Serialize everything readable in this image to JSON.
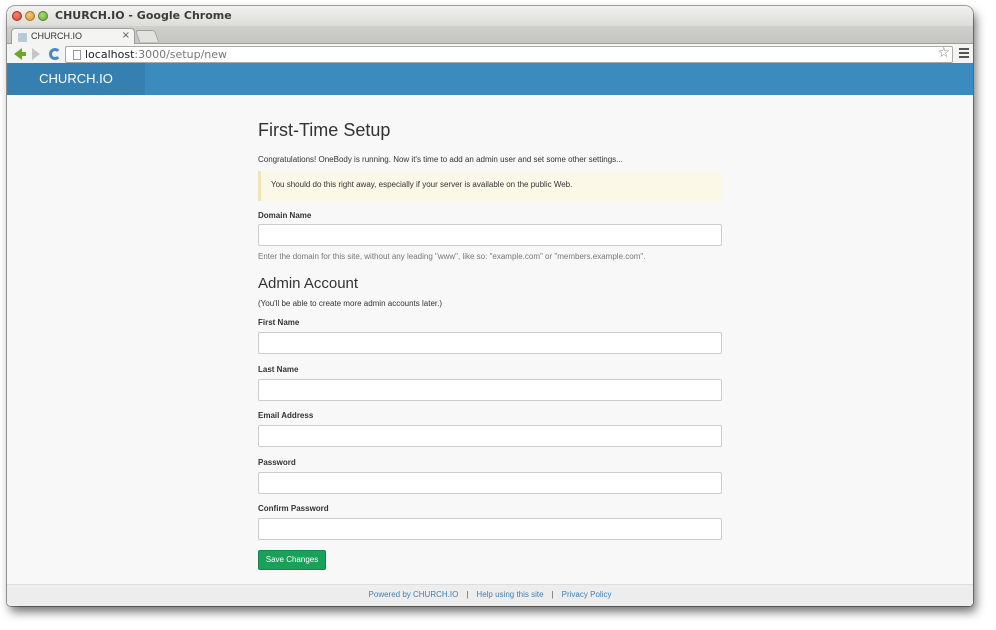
{
  "window": {
    "title": "CHURCH.IO - Google Chrome"
  },
  "tab": {
    "title": "CHURCH.IO",
    "close": "×"
  },
  "toolbar": {
    "url_host": "localhost",
    "url_rest": ":3000/setup/new",
    "star": "☆"
  },
  "navbar": {
    "brand": "CHURCH.IO"
  },
  "setup": {
    "title": "First-Time Setup",
    "intro": "Congratulations! OneBody is running. Now it's time to add an admin user and set some other settings...",
    "alert": "You should do this right away, especially if your server is available on the public Web.",
    "domain": {
      "label": "Domain Name",
      "value": "",
      "help": "Enter the domain for this site, without any leading \"www\", like so: \"example.com\" or \"members.example.com\"."
    },
    "admin_heading": "Admin Account",
    "admin_note": "(You'll be able to create more admin accounts later.)",
    "fields": [
      {
        "label": "First Name",
        "value": ""
      },
      {
        "label": "Last Name",
        "value": ""
      },
      {
        "label": "Email Address",
        "value": ""
      },
      {
        "label": "Password",
        "value": ""
      },
      {
        "label": "Confirm Password",
        "value": ""
      }
    ],
    "save_label": "Save Changes"
  },
  "footer": {
    "powered": "Powered by CHURCH.IO",
    "help": "Help using this site",
    "privacy": "Privacy Policy",
    "separator": "|"
  },
  "colors": {
    "navbar": "#3b8bbf",
    "brand_bg": "#3580b1",
    "save_button": "#19a05a",
    "link": "#3b82b8",
    "alert_bg": "#fcf8e8"
  }
}
